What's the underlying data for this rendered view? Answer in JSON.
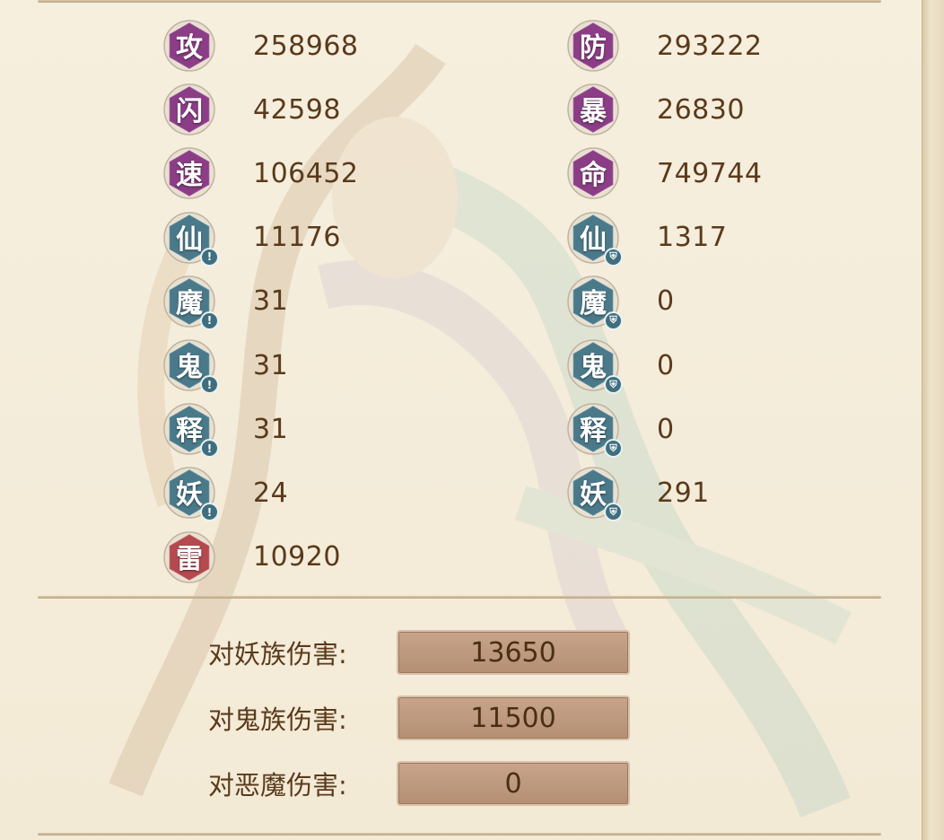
{
  "stats_left": [
    {
      "glyph": "攻",
      "value": "258968",
      "color": "#8b3d86",
      "mark": ""
    },
    {
      "glyph": "闪",
      "value": "42598",
      "color": "#8b3d86",
      "mark": ""
    },
    {
      "glyph": "速",
      "value": "106452",
      "color": "#8b3d86",
      "mark": ""
    },
    {
      "glyph": "仙",
      "value": "11176",
      "color": "#4a7a8a",
      "mark": "alert"
    },
    {
      "glyph": "魔",
      "value": "31",
      "color": "#4a7a8a",
      "mark": "alert"
    },
    {
      "glyph": "鬼",
      "value": "31",
      "color": "#4a7a8a",
      "mark": "alert"
    },
    {
      "glyph": "释",
      "value": "31",
      "color": "#4a7a8a",
      "mark": "alert"
    },
    {
      "glyph": "妖",
      "value": "24",
      "color": "#4a7a8a",
      "mark": "alert"
    },
    {
      "glyph": "雷",
      "value": "10920",
      "color": "#b44a4e",
      "mark": ""
    }
  ],
  "stats_right": [
    {
      "glyph": "防",
      "value": "293222",
      "color": "#8b3d86",
      "mark": ""
    },
    {
      "glyph": "暴",
      "value": "26830",
      "color": "#8b3d86",
      "mark": ""
    },
    {
      "glyph": "命",
      "value": "749744",
      "color": "#8b3d86",
      "mark": ""
    },
    {
      "glyph": "仙",
      "value": "1317",
      "color": "#4a7a8a",
      "mark": "shield"
    },
    {
      "glyph": "魔",
      "value": "0",
      "color": "#4a7a8a",
      "mark": "shield"
    },
    {
      "glyph": "鬼",
      "value": "0",
      "color": "#4a7a8a",
      "mark": "shield"
    },
    {
      "glyph": "释",
      "value": "0",
      "color": "#4a7a8a",
      "mark": "shield"
    },
    {
      "glyph": "妖",
      "value": "291",
      "color": "#4a7a8a",
      "mark": "shield"
    }
  ],
  "damage_bonus": [
    {
      "label": "对妖族伤害:",
      "value": "13650"
    },
    {
      "label": "对鬼族伤害:",
      "value": "11500"
    },
    {
      "label": "对恶魔伤害:",
      "value": "0"
    }
  ],
  "icons": {
    "alert": "exclamation-icon",
    "shield": "shield-icon"
  },
  "colors": {
    "text": "#5a3a1b",
    "panel": "#f4ecd9",
    "damage_box": "#b48f74"
  }
}
